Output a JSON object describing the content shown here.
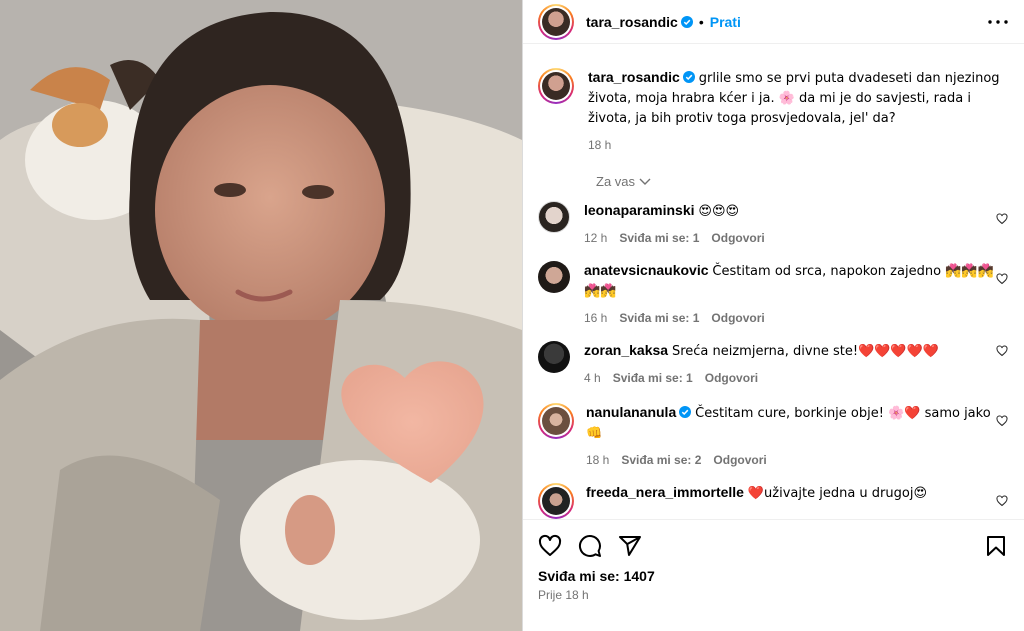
{
  "post": {
    "username": "tara_rosandic",
    "follow_label": "Prati",
    "dot": "•",
    "caption": "grlile smo se prvi puta dvadeseti dan njezinog života, moja hrabra kćer i ja. 🌸 da mi je do savjesti, rada i života, ja bih protiv toga prosvjedovala, jel' da?",
    "caption_time": "18 h",
    "for_you": "Za vas"
  },
  "comments": [
    {
      "username": "leonaparaminski",
      "text": "😍😍😍",
      "time": "12 h",
      "likes": "Sviđa mi se: 1",
      "reply": "Odgovori",
      "verified": false
    },
    {
      "username": "anatevsicnaukovic",
      "text": "Čestitam od srca, napokon zajedno 💏💏💏💏💏",
      "time": "16 h",
      "likes": "Sviđa mi se: 1",
      "reply": "Odgovori",
      "verified": false
    },
    {
      "username": "zoran_kaksa",
      "text": "Sreća neizmjerna, divne ste!❤️❤️❤️❤️❤️",
      "time": "4 h",
      "likes": "Sviđa mi se: 1",
      "reply": "Odgovori",
      "verified": false
    },
    {
      "username": "nanulananula",
      "text": "Čestitam cure, borkinje obje! 🌸❤️ samo jako 👊",
      "time": "18 h",
      "likes": "Sviđa mi se: 2",
      "reply": "Odgovori",
      "verified": true
    },
    {
      "username": "freeda_nera_immortelle",
      "text": "❤️uživajte jedna u drugoj😍",
      "time": "",
      "likes": "",
      "reply": "",
      "verified": false
    }
  ],
  "footer": {
    "likes_label": "Sviđa mi se: 1407",
    "time_ago": "Prije 18 h"
  },
  "colors": {
    "link": "#0095f6",
    "muted": "#737373",
    "border": "#dbdbdb"
  },
  "icons": [
    "more-icon",
    "verified-icon",
    "heart-icon",
    "comment-icon",
    "share-icon",
    "bookmark-icon",
    "chevron-down-icon"
  ]
}
